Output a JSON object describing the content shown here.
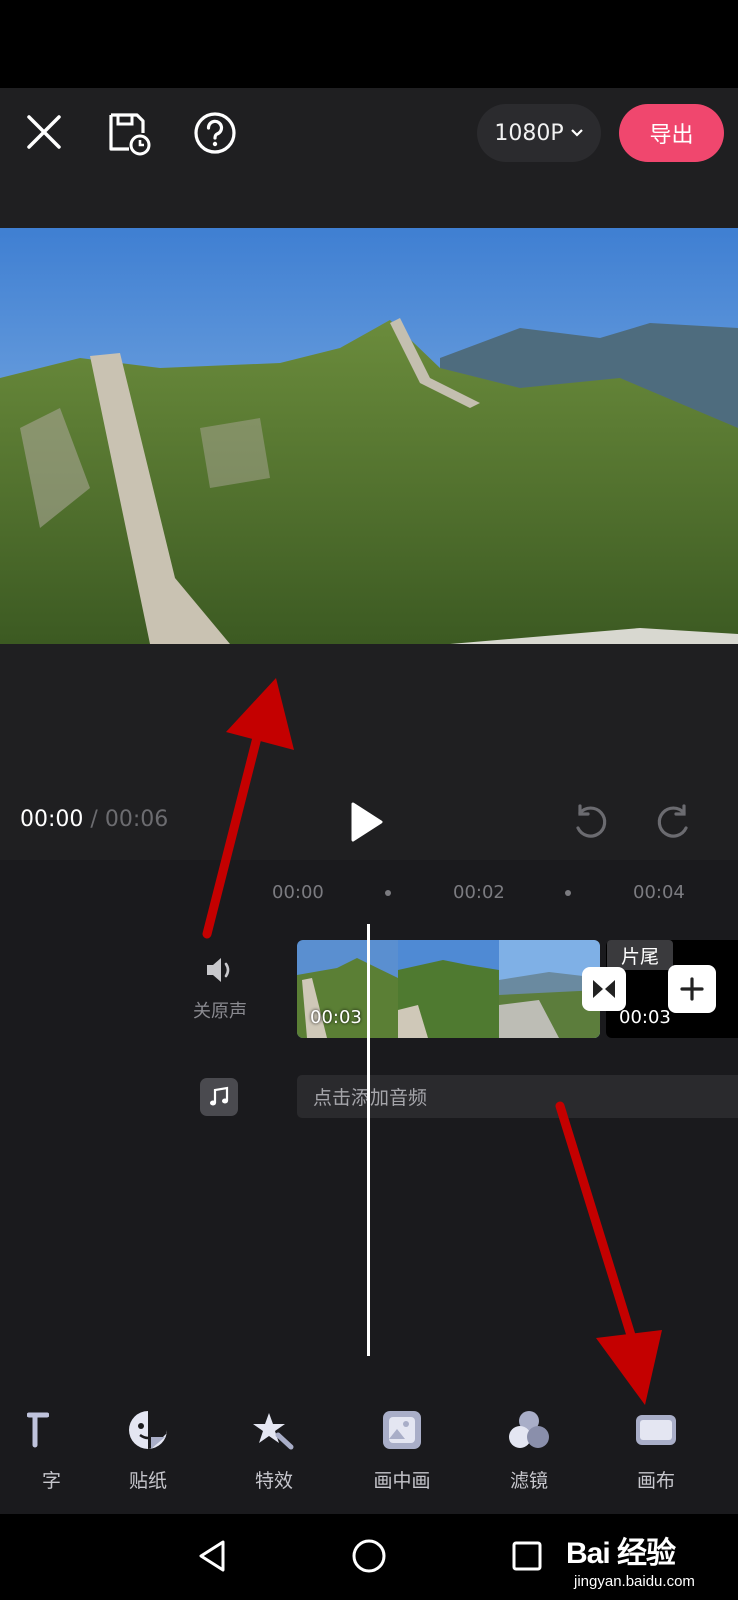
{
  "header": {
    "resolution": "1080P",
    "export_label": "导出"
  },
  "playback": {
    "current_time": "00:00",
    "separator": "/",
    "total_time": "00:06"
  },
  "ruler": {
    "labels": [
      "00:00",
      "00:02",
      "00:04"
    ]
  },
  "track": {
    "mute_label": "关原声",
    "clip_duration": "00:03",
    "end_label": "片尾",
    "end_duration": "00:03",
    "audio_placeholder": "点击添加音频"
  },
  "toolbar": {
    "items": [
      {
        "label": "字",
        "icon": "text-icon"
      },
      {
        "label": "贴纸",
        "icon": "sticker-icon"
      },
      {
        "label": "特效",
        "icon": "effects-icon"
      },
      {
        "label": "画中画",
        "icon": "picture-in-picture-icon"
      },
      {
        "label": "滤镜",
        "icon": "filter-icon"
      },
      {
        "label": "画布",
        "icon": "canvas-icon"
      }
    ]
  },
  "watermark": {
    "main": "Bai 经验",
    "sub": "jingyan.baidu.com"
  },
  "colors": {
    "accent": "#f0476e",
    "background": "#1a1a1d",
    "annotation_arrow": "#c40000"
  }
}
